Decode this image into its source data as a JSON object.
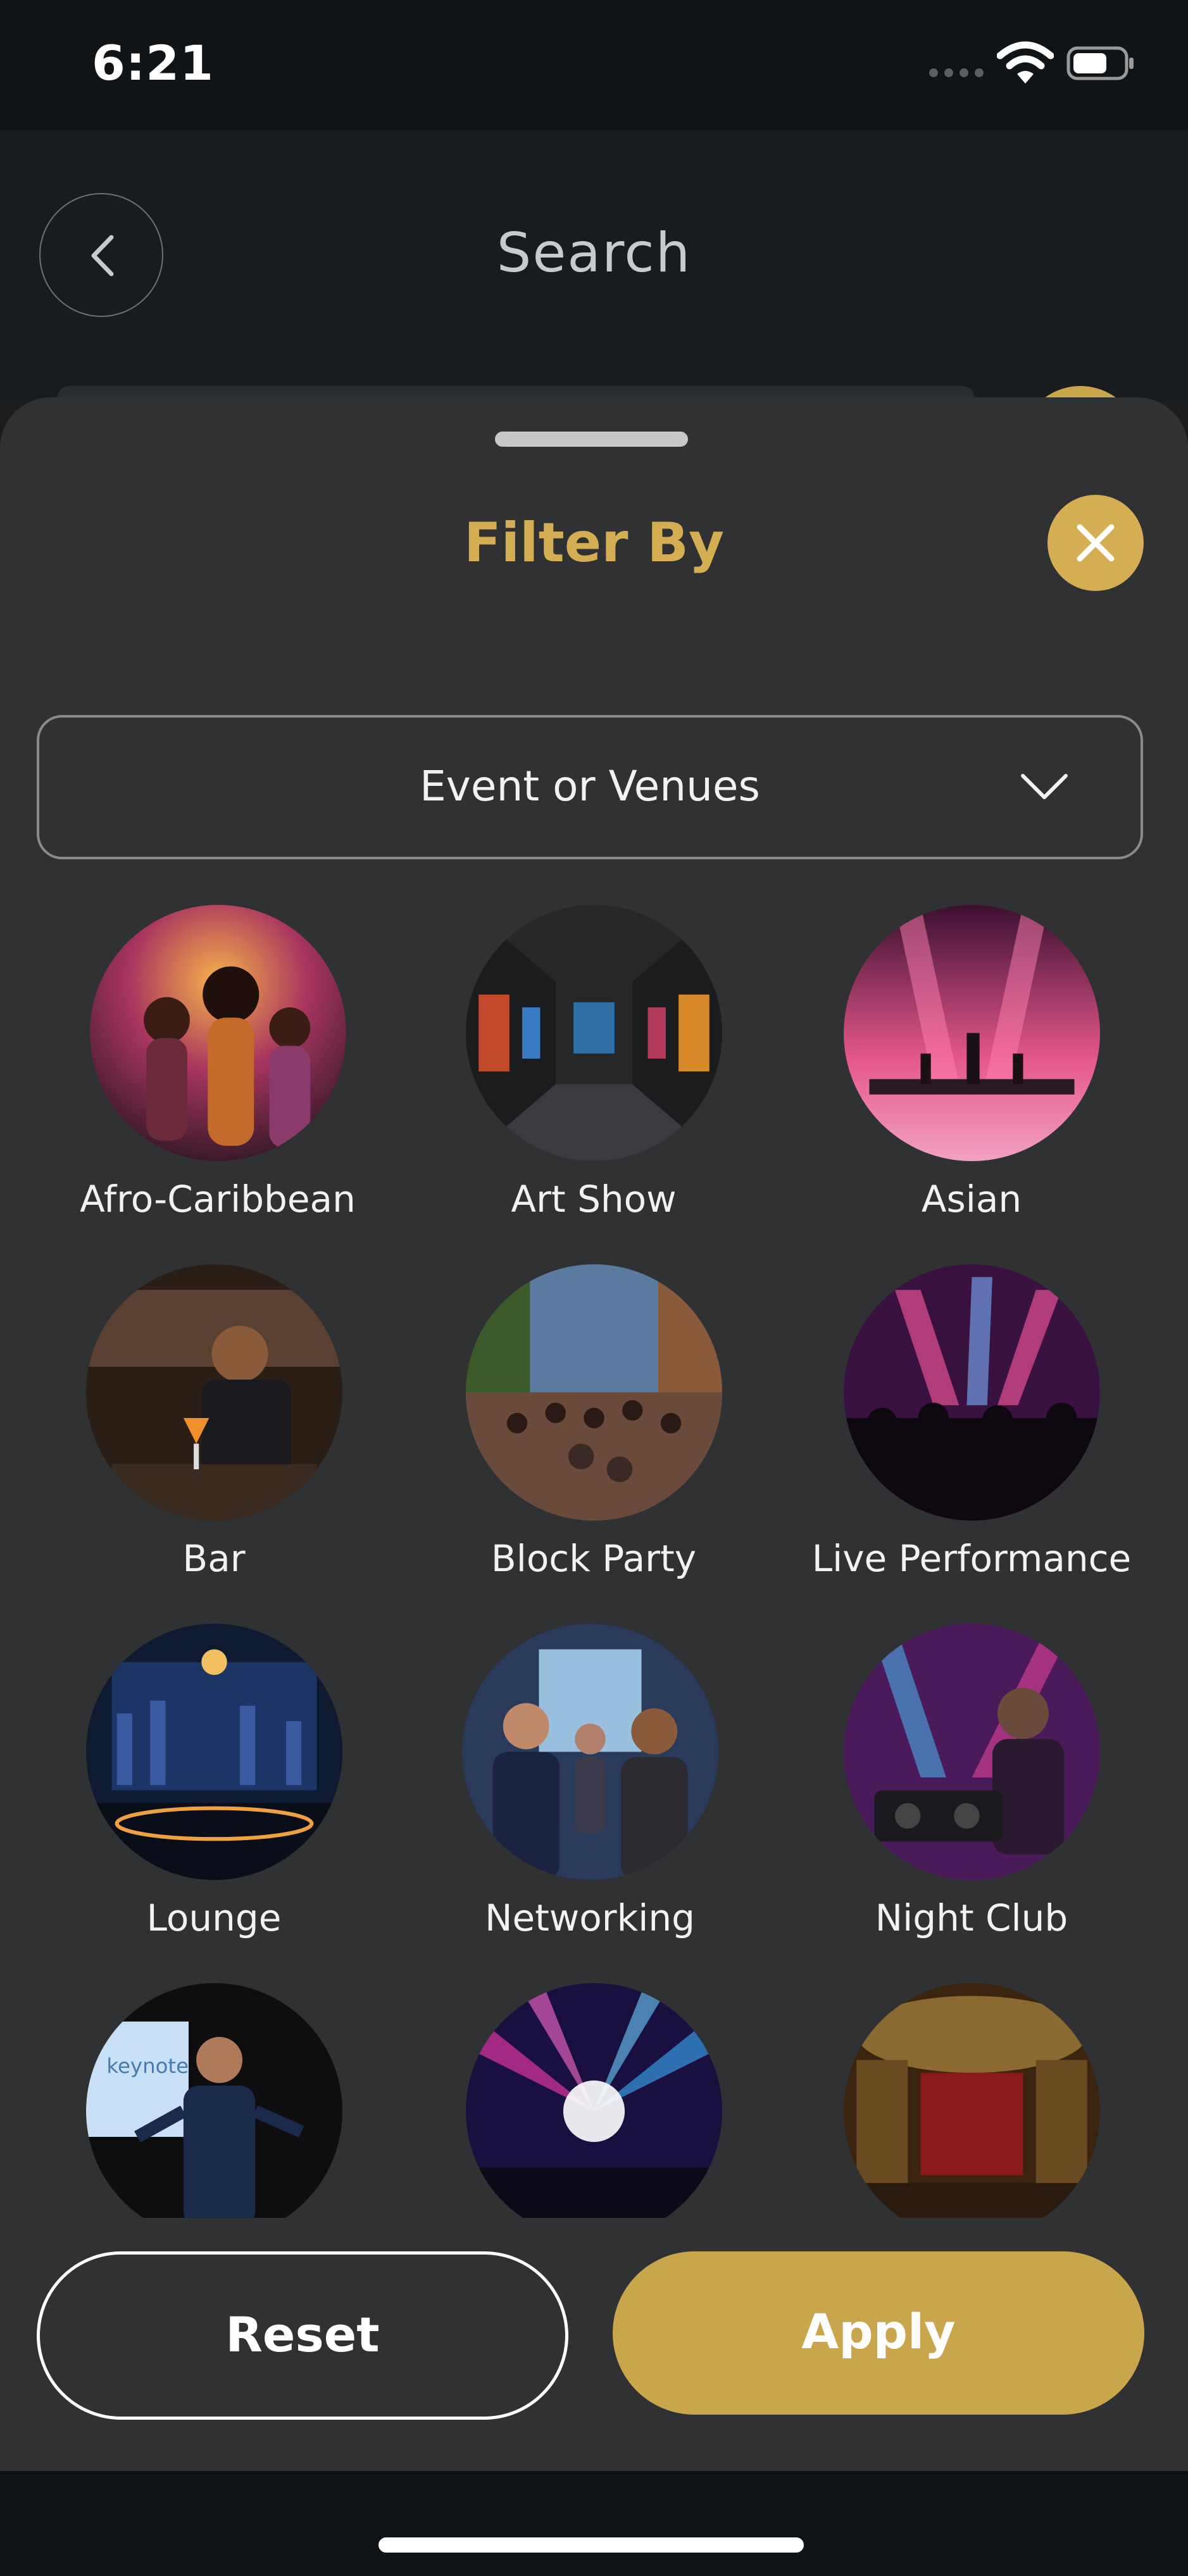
{
  "status_bar": {
    "time": "6:21"
  },
  "header": {
    "title": "Search"
  },
  "filter_sheet": {
    "title": "Filter By",
    "dropdown": {
      "selected": "Event or Venues"
    },
    "categories": [
      {
        "label": "Afro-Caribbean"
      },
      {
        "label": "Art Show"
      },
      {
        "label": "Asian"
      },
      {
        "label": "Bar"
      },
      {
        "label": "Block Party"
      },
      {
        "label": "Live Performance"
      },
      {
        "label": "Lounge"
      },
      {
        "label": "Networking"
      },
      {
        "label": "Night Club"
      },
      {
        "label": ""
      },
      {
        "label": ""
      },
      {
        "label": ""
      }
    ],
    "keynote_text": "keynote",
    "reset_label": "Reset",
    "apply_label": "Apply"
  },
  "colors": {
    "accent": "#D5AD52",
    "apply_button": "#C9A54B",
    "sheet_bg": "#303132"
  }
}
